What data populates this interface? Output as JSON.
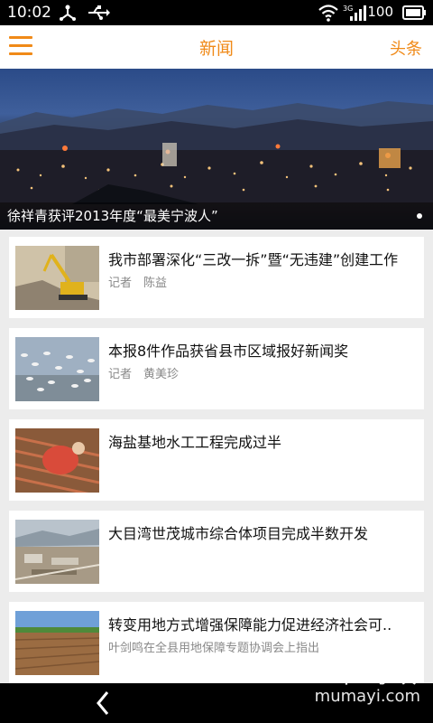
{
  "status_bar": {
    "time": "10:02",
    "battery": "100",
    "icons": [
      "usb-branch-icon",
      "usb-icon",
      "wifi-icon",
      "signal-3g-icon",
      "battery-icon"
    ]
  },
  "app_bar": {
    "title": "新闻",
    "right_link": "头条",
    "menu_icon": "hamburger-menu-icon",
    "accent_color": "#f08a18"
  },
  "hero": {
    "caption": "徐祥青获评2013年度“最美宁波人”"
  },
  "news": [
    {
      "title": "我市部署深化“三改一拆”暨“无违建”创建工作",
      "sub": "记者　陈益",
      "thumb": "excavator-demolition"
    },
    {
      "title": "本报8件作品获省县市区域报好新闻奖",
      "sub": "记者　黄美珍",
      "thumb": "birds-flock"
    },
    {
      "title": "海盐基地水工工程完成过半",
      "sub": "",
      "thumb": "worker-rebar"
    },
    {
      "title": "大目湾世茂城市综合体项目完成半数开发",
      "sub": "",
      "thumb": "aerial-construction"
    },
    {
      "title": "转变用地方式增强保障能力促进经济社会可..",
      "sub": "叶剑鸣在全县用地保障专题协调会上指出",
      "thumb": "farmland-field"
    }
  ],
  "nav": {
    "back_icon": "back-chevron-icon"
  },
  "watermark": {
    "cn": "木蚂蚁",
    "en": "mumayi.com"
  }
}
